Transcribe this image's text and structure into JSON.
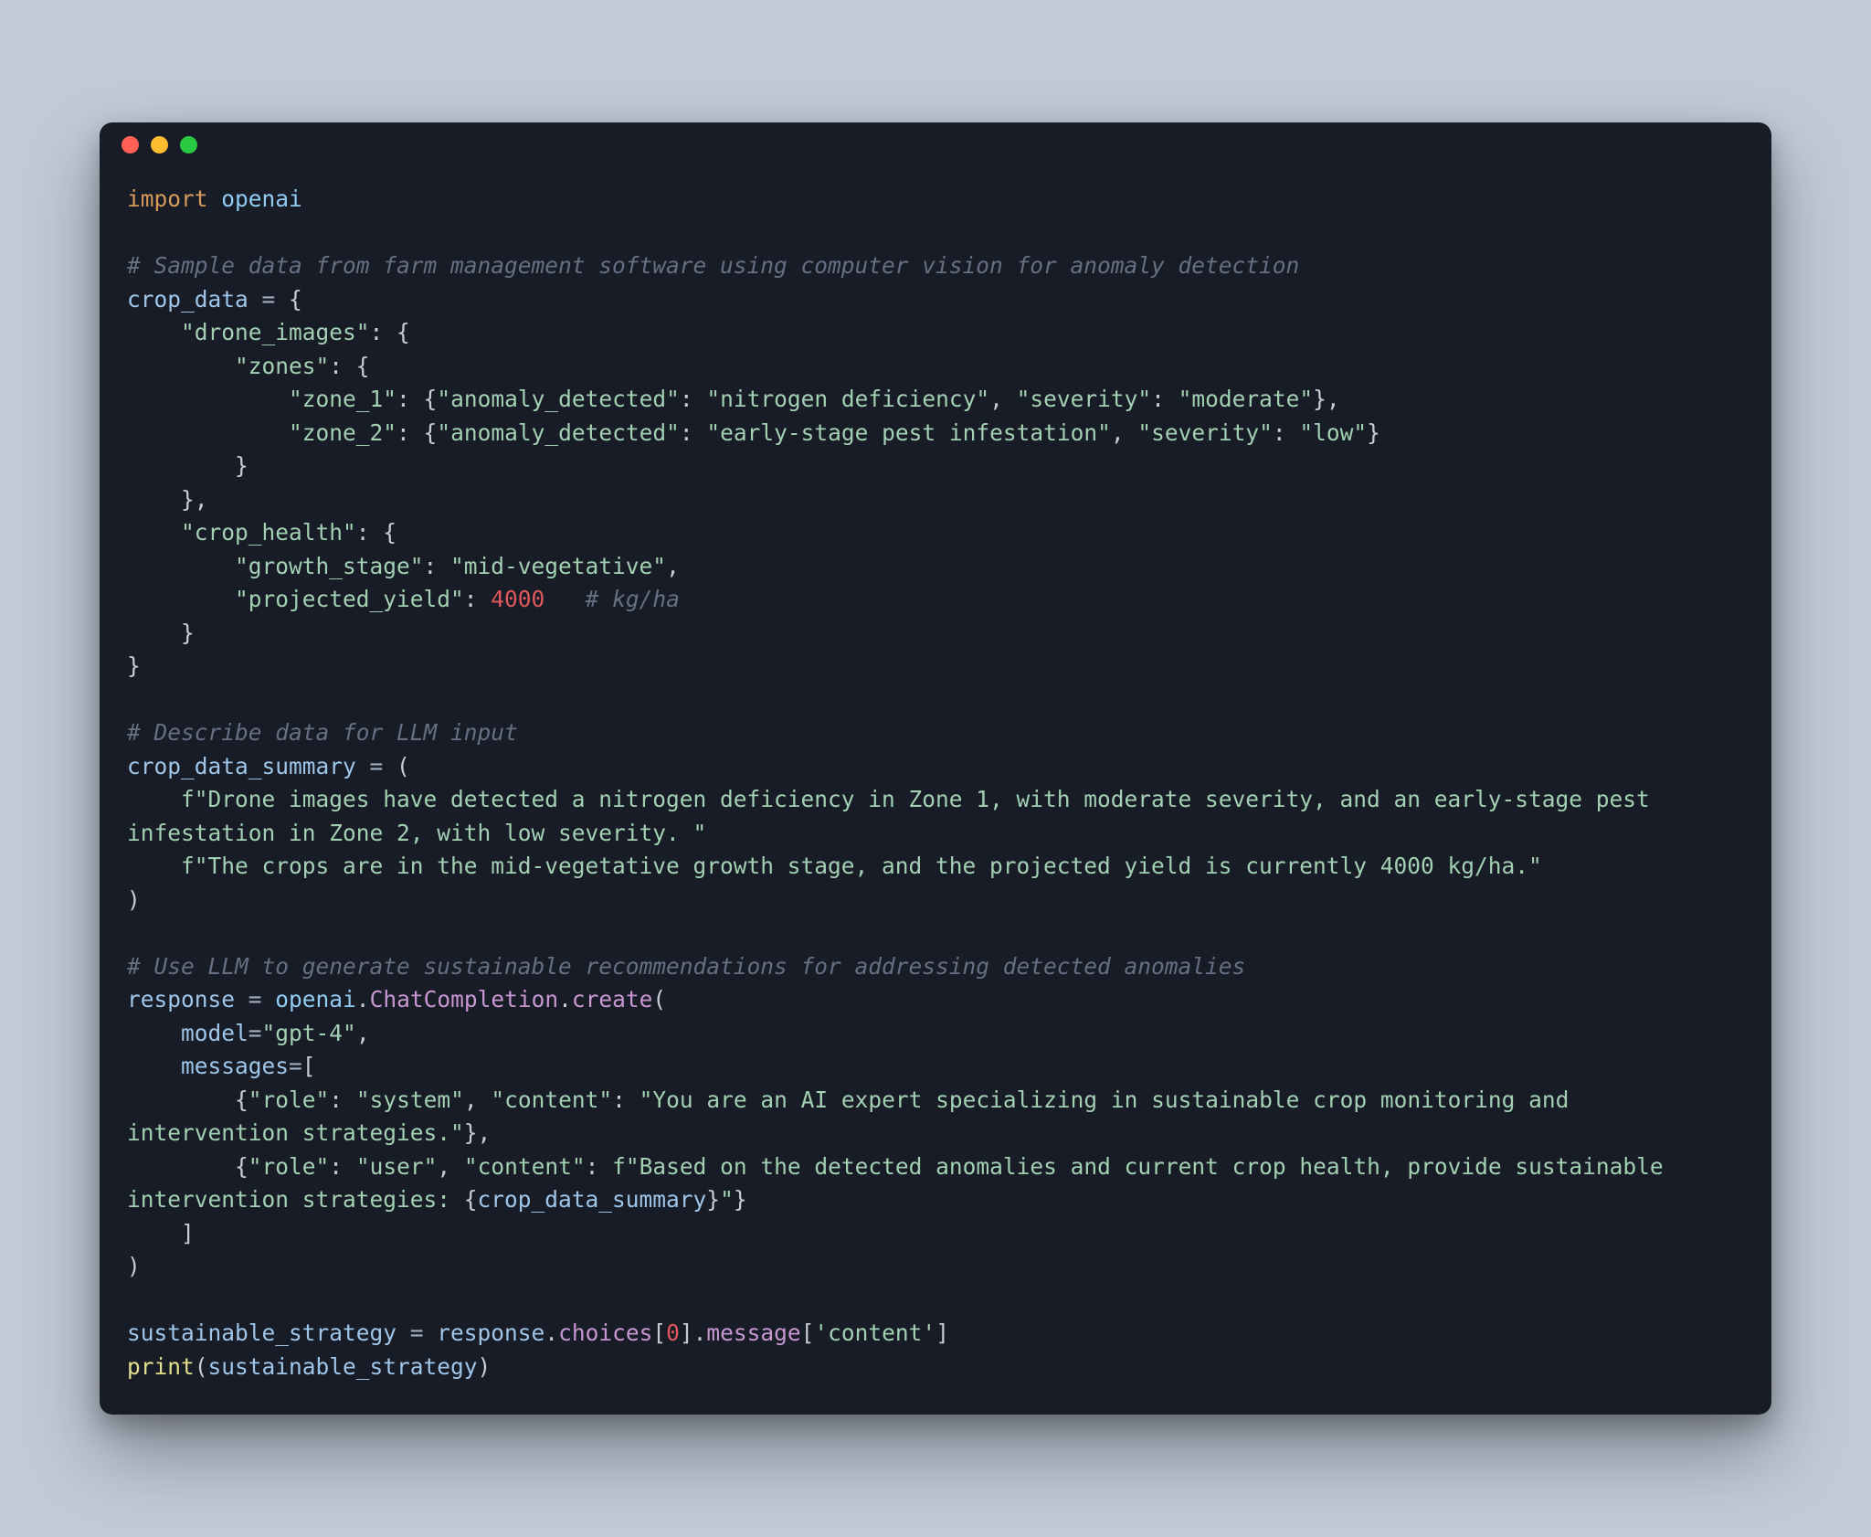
{
  "code": {
    "l1_kw": "import",
    "l1_mod": "openai",
    "l2": "",
    "l3_cm": "# Sample data from farm management software using computer vision for anomaly detection",
    "l4_var": "crop_data",
    "l4_op": " = ",
    "l4_pn": "{",
    "l5_pad": "    ",
    "l5_str": "\"drone_images\"",
    "l5_pn1": ": ",
    "l5_pn2": "{",
    "l6_pad": "        ",
    "l6_str": "\"zones\"",
    "l6_pn1": ": ",
    "l6_pn2": "{",
    "l7_pad": "            ",
    "l7_k": "\"zone_1\"",
    "l7_c": ": ",
    "l7_ob": "{",
    "l7_k2": "\"anomaly_detected\"",
    "l7_c2": ": ",
    "l7_v2": "\"nitrogen deficiency\"",
    "l7_cma": ", ",
    "l7_k3": "\"severity\"",
    "l7_c3": ": ",
    "l7_v3": "\"moderate\"",
    "l7_cb": "},",
    "l8_pad": "            ",
    "l8_k": "\"zone_2\"",
    "l8_c": ": ",
    "l8_ob": "{",
    "l8_k2": "\"anomaly_detected\"",
    "l8_c2": ": ",
    "l8_v2": "\"early-stage pest infestation\"",
    "l8_cma": ", ",
    "l8_k3": "\"severity\"",
    "l8_c3": ": ",
    "l8_v3": "\"low\"",
    "l8_cb": "}",
    "l9_pad": "        ",
    "l9_pn": "}",
    "l10_pad": "    ",
    "l10_pn": "},",
    "l11_pad": "    ",
    "l11_str": "\"crop_health\"",
    "l11_pn1": ": ",
    "l11_pn2": "{",
    "l12_pad": "        ",
    "l12_k": "\"growth_stage\"",
    "l12_c": ": ",
    "l12_v": "\"mid-vegetative\"",
    "l12_cm": ",",
    "l13_pad": "        ",
    "l13_k": "\"projected_yield\"",
    "l13_c": ": ",
    "l13_num": "4000",
    "l13_sp": "   ",
    "l13_cm": "# kg/ha",
    "l14_pad": "    ",
    "l14_pn": "}",
    "l15_pn": "}",
    "l16": "",
    "l17_cm": "# Describe data for LLM input",
    "l18_var": "crop_data_summary",
    "l18_op": " = ",
    "l18_pn": "(",
    "l19_pad": "    ",
    "l19_str": "f\"Drone images have detected a nitrogen deficiency in Zone 1, with moderate severity, and an early-stage pest infestation in Zone 2, with low severity. \"",
    "l20_pad": "    ",
    "l20_str": "f\"The crops are in the mid-vegetative growth stage, and the projected yield is currently 4000 kg/ha.\"",
    "l21_pn": ")",
    "l22": "",
    "l23_cm": "# Use LLM to generate sustainable recommendations for addressing detected anomalies",
    "l24_var": "response",
    "l24_op": " = ",
    "l24_m1": "openai",
    "l24_d1": ".",
    "l24_m2": "ChatCompletion",
    "l24_d2": ".",
    "l24_m3": "create",
    "l24_pn": "(",
    "l25_pad": "    ",
    "l25_k": "model",
    "l25_eq": "=",
    "l25_v": "\"gpt-4\"",
    "l25_cm": ",",
    "l26_pad": "    ",
    "l26_k": "messages",
    "l26_eq": "=",
    "l26_ob": "[",
    "l27_pad": "        ",
    "l27_ob": "{",
    "l27_k1": "\"role\"",
    "l27_c1": ": ",
    "l27_v1": "\"system\"",
    "l27_cma1": ", ",
    "l27_k2": "\"content\"",
    "l27_c2": ": ",
    "l27_v2": "\"You are an AI expert specializing in sustainable crop monitoring and intervention strategies.\"",
    "l27_cb": "},",
    "l28_pad": "        ",
    "l28_ob": "{",
    "l28_k1": "\"role\"",
    "l28_c1": ": ",
    "l28_v1": "\"user\"",
    "l28_cma1": ", ",
    "l28_k2": "\"content\"",
    "l28_c2": ": ",
    "l28_v2a": "f\"Based on the detected anomalies and current crop health, provide sustainable intervention strategies: ",
    "l28_ip1": "{",
    "l28_iv": "crop_data_summary",
    "l28_ip2": "}",
    "l28_v2b": "\"",
    "l28_cb": "}",
    "l29_pad": "    ",
    "l29_pn": "]",
    "l30_pn": ")",
    "l31": "",
    "l32_var": "sustainable_strategy",
    "l32_op": " = ",
    "l32_r": "response",
    "l32_d1": ".",
    "l32_ch": "choices",
    "l32_ob": "[",
    "l32_num": "0",
    "l32_cb": "]",
    "l32_d2": ".",
    "l32_msg": "message",
    "l32_ob2": "[",
    "l32_key": "'content'",
    "l32_cb2": "]",
    "l33_fn": "print",
    "l33_ob": "(",
    "l33_arg": "sustainable_strategy",
    "l33_cb": ")"
  }
}
